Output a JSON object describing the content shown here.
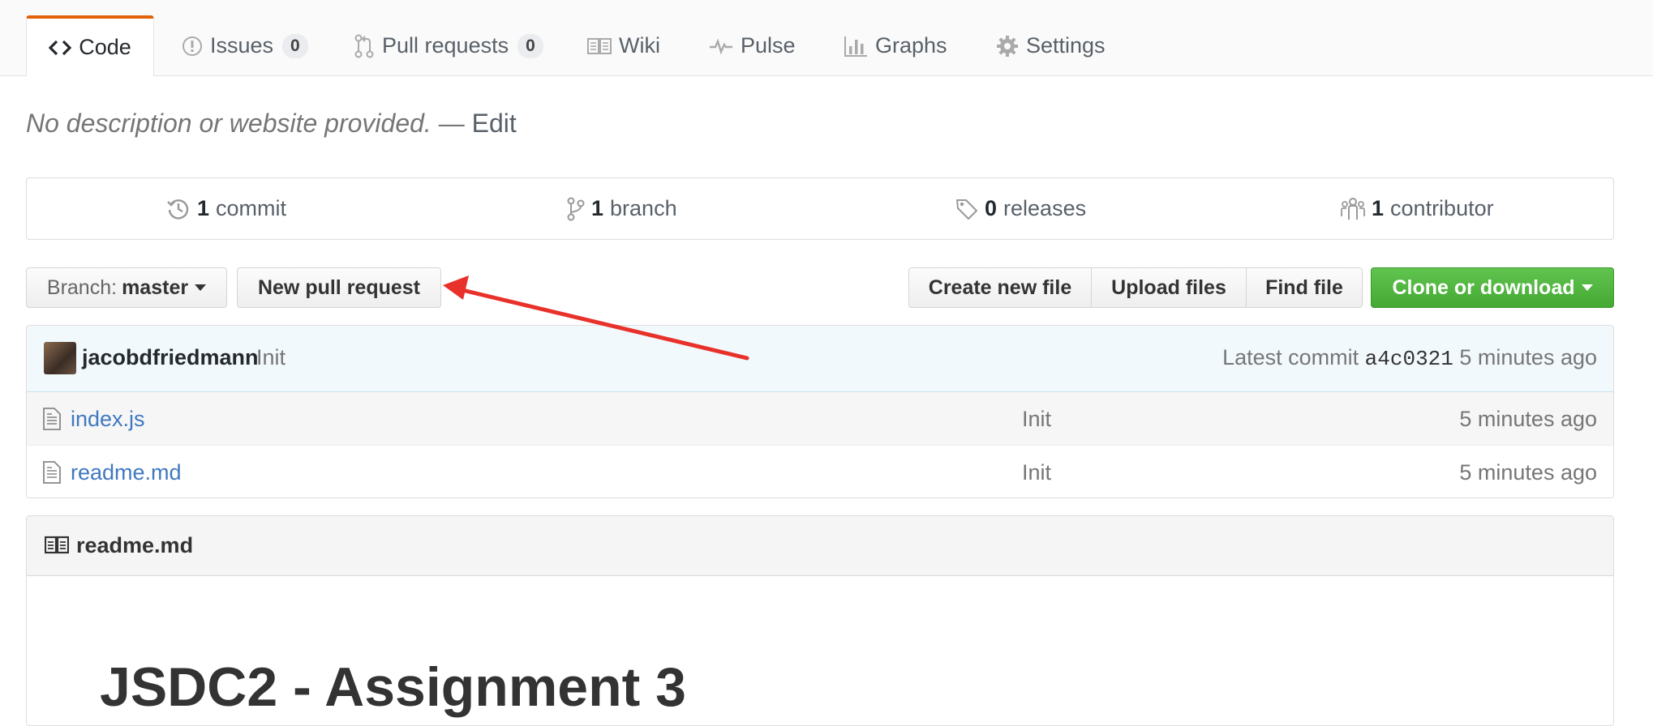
{
  "tabs": [
    {
      "label": "Code"
    },
    {
      "label": "Issues",
      "count": "0"
    },
    {
      "label": "Pull requests",
      "count": "0"
    },
    {
      "label": "Wiki"
    },
    {
      "label": "Pulse"
    },
    {
      "label": "Graphs"
    },
    {
      "label": "Settings"
    }
  ],
  "description": {
    "text": "No description or website provided.",
    "separator": " — ",
    "edit": "Edit"
  },
  "summary": {
    "commits": {
      "count": "1",
      "label": "commit"
    },
    "branches": {
      "count": "1",
      "label": "branch"
    },
    "releases": {
      "count": "0",
      "label": "releases"
    },
    "contributors": {
      "count": "1",
      "label": "contributor"
    }
  },
  "controls": {
    "branch_prefix": "Branch:",
    "branch_name": "master",
    "new_pull_request": "New pull request",
    "create_new_file": "Create new file",
    "upload_files": "Upload files",
    "find_file": "Find file",
    "clone_or_download": "Clone or download"
  },
  "latest_commit": {
    "author": "jacobdfriedmann",
    "message": "Init",
    "prefix": "Latest commit",
    "sha": "a4c0321",
    "age": "5 minutes ago"
  },
  "files": [
    {
      "name": "index.js",
      "message": "Init",
      "age": "5 minutes ago"
    },
    {
      "name": "readme.md",
      "message": "Init",
      "age": "5 minutes ago"
    }
  ],
  "readme": {
    "filename": "readme.md",
    "heading": "JSDC2 - Assignment 3"
  },
  "colors": {
    "accent_tab": "#e36209",
    "link": "#4078c0",
    "clone_button": "#55b842",
    "annotation_arrow": "#e8312a"
  }
}
